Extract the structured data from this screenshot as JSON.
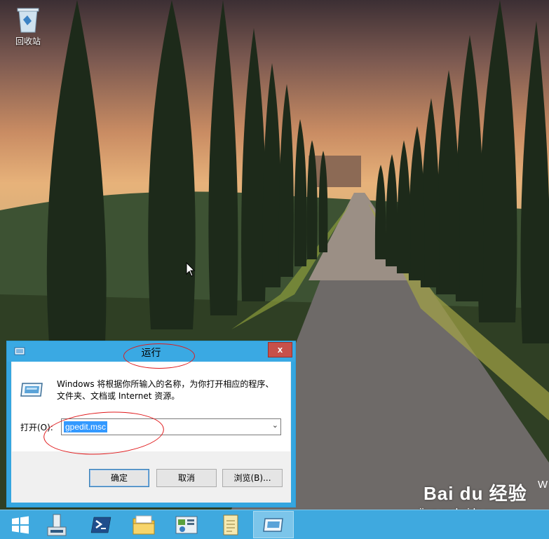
{
  "desktop": {
    "icons": [
      {
        "label": "回收站",
        "icon": "recycle-bin-icon"
      }
    ],
    "corner_text": "W"
  },
  "run_dialog": {
    "title": "运行",
    "description_line1": "Windows 将根据你所输入的名称，为你打开相应的程序、",
    "description_line2": "文件夹、文档或 Internet 资源。",
    "open_label": "打开(O):",
    "open_value": "gpedit.msc",
    "buttons": {
      "ok": "确定",
      "cancel": "取消",
      "browse": "浏览(B)..."
    },
    "close_glyph": "x"
  },
  "taskbar": {
    "items": [
      {
        "icon": "windows-start-icon"
      },
      {
        "icon": "server-manager-icon"
      },
      {
        "icon": "powershell-icon"
      },
      {
        "icon": "file-explorer-icon"
      },
      {
        "icon": "control-panel-icon"
      },
      {
        "icon": "notepad-icon"
      },
      {
        "icon": "run-icon",
        "active": true
      }
    ]
  },
  "watermark": {
    "brand": "Bai du 经验",
    "url": "jingyan.baidu.com"
  },
  "colors": {
    "taskbar": "#3fa9df",
    "titlebar": "#3aa9e3",
    "close_button": "#c7504a",
    "selection": "#3399ff",
    "annotation": "#e0191b"
  }
}
